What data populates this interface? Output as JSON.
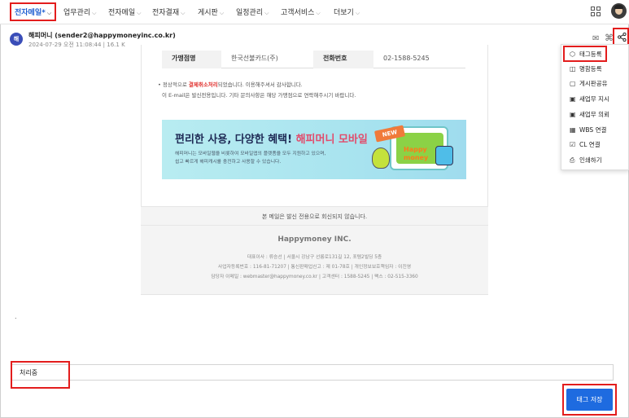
{
  "nav": {
    "items": [
      {
        "label": "전자메일*",
        "active": true
      },
      {
        "label": "업무관리",
        "active": false
      },
      {
        "label": "전자메일",
        "active": false
      },
      {
        "label": "전자결재",
        "active": false
      },
      {
        "label": "게시판",
        "active": false
      },
      {
        "label": "일정관리",
        "active": false
      },
      {
        "label": "고객서비스",
        "active": false
      },
      {
        "label": "더보기",
        "active": false
      }
    ],
    "chevron": "⌵",
    "apps_icon": "grid-icon",
    "user_icon": "avatar"
  },
  "message": {
    "sender_initial": "해",
    "sender": "해피머니 (sender2@happymoneyinc.co.kr)",
    "meta": "2024-07-29 오전 11:08:44 | 16.1 K",
    "icons": {
      "mail": "✉",
      "hash": "⌘",
      "share": "⋖"
    }
  },
  "menu": {
    "items": [
      {
        "label": "태그등록",
        "icon": "⬡"
      },
      {
        "label": "명함등록",
        "icon": "◫"
      },
      {
        "label": "게시판공유",
        "icon": "▢"
      },
      {
        "label": "새업무 지시",
        "icon": "▣"
      },
      {
        "label": "새업무 의뢰",
        "icon": "▣"
      },
      {
        "label": "WBS 연결",
        "icon": "▦"
      },
      {
        "label": "CL 연결",
        "icon": "☑"
      },
      {
        "label": "인쇄하기",
        "icon": "⎙"
      }
    ]
  },
  "email": {
    "table": {
      "col1_header": "가맹점명",
      "col1_value": "한국선불카드(주)",
      "col2_header": "전화번호",
      "col2_value": "02-1588-5245"
    },
    "notice_prefix": "• 정상적으로 ",
    "notice_highlight": "결제취소처리",
    "notice_suffix": "되었습니다. 이용해주셔서 감사합니다.",
    "notice_line2": "이 E-mail은 발신전용입니다. 기타 문의사항은 해당 가맹점으로 연락해주시기 바랍니다.",
    "banner": {
      "title_prefix": "편리한 사용, 다양한 혜택! ",
      "title_brand": "해피머니 모바일",
      "sub1": "해피머니는 모바일웹을 비롯하여 모바일앱의 플랫폼을 모두 지원하고 있으며,",
      "sub2": "쉽고 빠르게 해피캐시를 충전하고 사용할 수 있습니다.",
      "badge": "NEW",
      "logo_line1": "Happy",
      "logo_line2": "money"
    },
    "footer_notice": "본 메일은 발신 전용으로 회신되지 않습니다.",
    "company": "Happymoney INC.",
    "footer_line1": "대표이사 : 류승선 | 서울시 강남구 선릉로131길 12, 포템2빌딩 5층",
    "footer_line2": "사업자등록번호 : 116-81-71207 | 통신판매업신고 : 제 01-78호 | 개인정보보호책임자 : 이진영",
    "footer_line3": "담당자 이메일 : webmaster@happymoney.co.kr | 고객센터 : 1588-5245 | 팩스 : 02-515-3360"
  },
  "body_dot": ".",
  "tag_input": {
    "value": "처리중"
  },
  "save_button": {
    "label": "태그 저장"
  },
  "colors": {
    "accent": "#1e6be0",
    "highlight": "#e31d1d"
  }
}
